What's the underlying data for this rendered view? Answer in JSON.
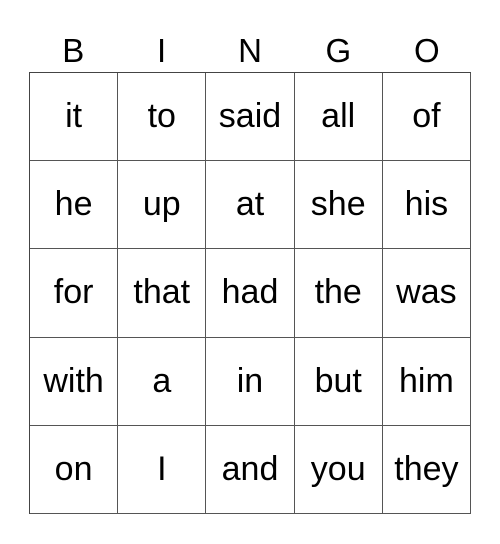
{
  "header": [
    "B",
    "I",
    "N",
    "G",
    "O"
  ],
  "rows": [
    [
      "it",
      "to",
      "said",
      "all",
      "of"
    ],
    [
      "he",
      "up",
      "at",
      "she",
      "his"
    ],
    [
      "for",
      "that",
      "had",
      "the",
      "was"
    ],
    [
      "with",
      "a",
      "in",
      "but",
      "him"
    ],
    [
      "on",
      "I",
      "and",
      "you",
      "they"
    ]
  ]
}
